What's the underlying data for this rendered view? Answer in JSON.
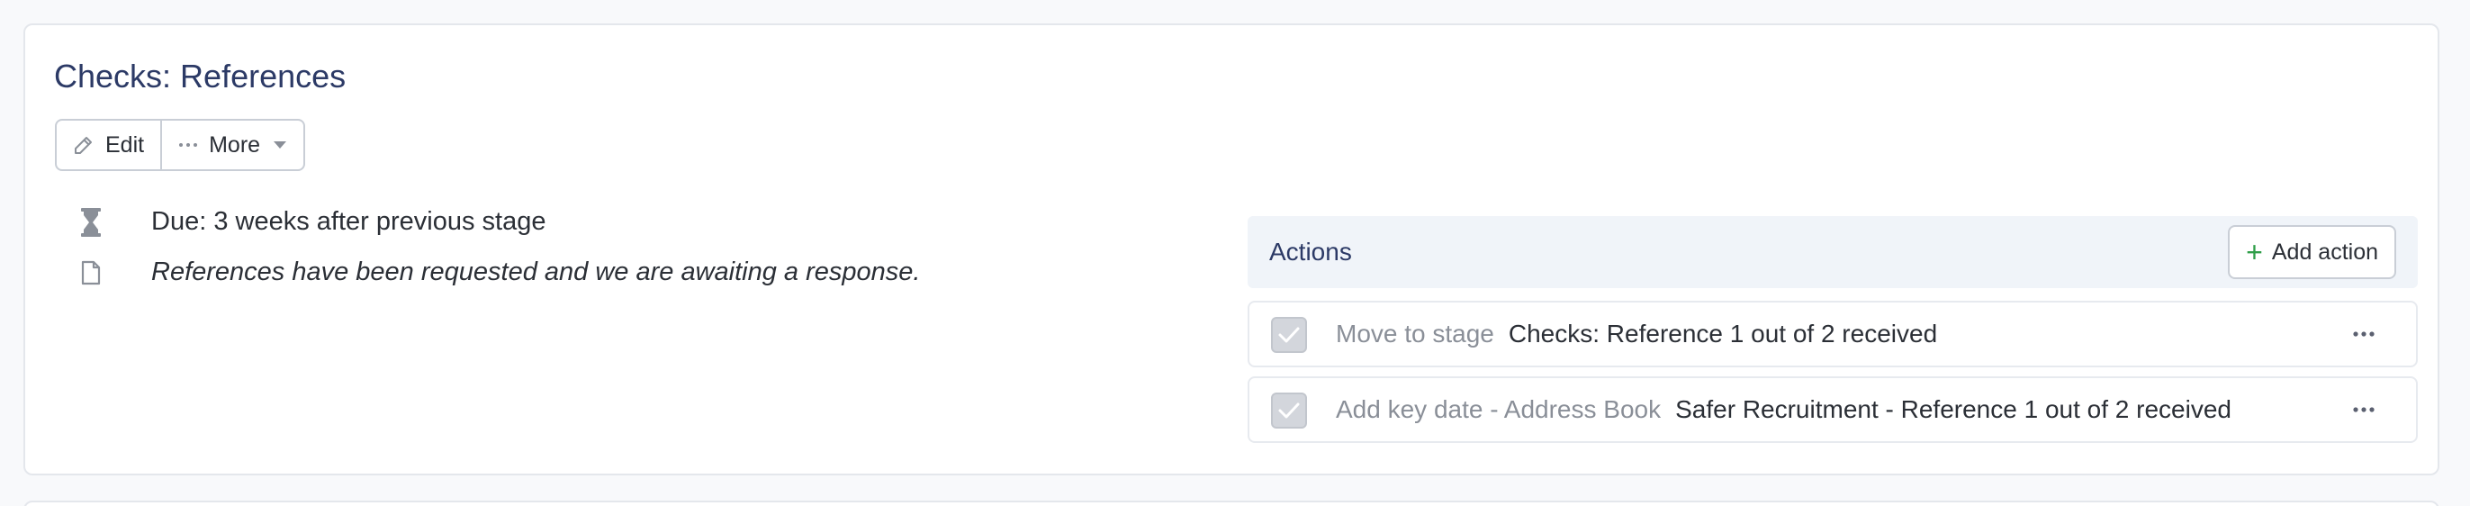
{
  "stage": {
    "title": "Checks: References",
    "toolbar": {
      "edit_label": "Edit",
      "more_label": "More"
    },
    "due": "Due: 3 weeks after previous stage",
    "note": "References have been requested and we are awaiting a response."
  },
  "actions": {
    "title": "Actions",
    "add_label": "Add action",
    "add_color": "#2f9e49",
    "items": [
      {
        "label": "Move to stage",
        "value": "Checks: Reference 1 out of 2 received",
        "completed": true
      },
      {
        "label": "Add key date - Address Book",
        "value": "Safer Recruitment - Reference 1 out of 2 received",
        "completed": true
      }
    ]
  },
  "colors": {
    "title": "#2c3a66",
    "actions_header_bg": "#f0f4f9",
    "muted_text": "#8a8f98"
  },
  "icons": {
    "edit": "pencil-icon",
    "more": "ellipsis-icon",
    "dropdown": "caret-down-icon",
    "due": "hourglass-icon",
    "note": "document-icon",
    "add": "plus-icon",
    "check": "checkmark-icon",
    "row_menu": "ellipsis-icon"
  }
}
